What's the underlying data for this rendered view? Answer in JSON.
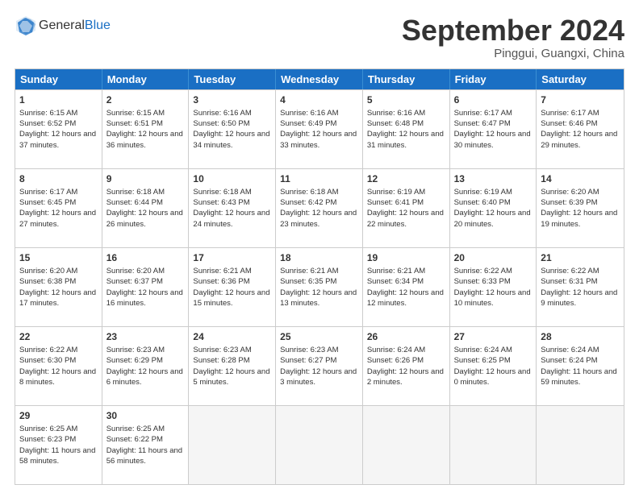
{
  "header": {
    "logo_general": "General",
    "logo_blue": "Blue",
    "month_title": "September 2024",
    "location": "Pinggui, Guangxi, China"
  },
  "weekdays": [
    "Sunday",
    "Monday",
    "Tuesday",
    "Wednesday",
    "Thursday",
    "Friday",
    "Saturday"
  ],
  "rows": [
    [
      {
        "day": "",
        "info": ""
      },
      {
        "day": "2",
        "info": "Sunrise: 6:15 AM\nSunset: 6:51 PM\nDaylight: 12 hours\nand 36 minutes."
      },
      {
        "day": "3",
        "info": "Sunrise: 6:16 AM\nSunset: 6:50 PM\nDaylight: 12 hours\nand 34 minutes."
      },
      {
        "day": "4",
        "info": "Sunrise: 6:16 AM\nSunset: 6:49 PM\nDaylight: 12 hours\nand 33 minutes."
      },
      {
        "day": "5",
        "info": "Sunrise: 6:16 AM\nSunset: 6:48 PM\nDaylight: 12 hours\nand 31 minutes."
      },
      {
        "day": "6",
        "info": "Sunrise: 6:17 AM\nSunset: 6:47 PM\nDaylight: 12 hours\nand 30 minutes."
      },
      {
        "day": "7",
        "info": "Sunrise: 6:17 AM\nSunset: 6:46 PM\nDaylight: 12 hours\nand 29 minutes."
      }
    ],
    [
      {
        "day": "8",
        "info": "Sunrise: 6:17 AM\nSunset: 6:45 PM\nDaylight: 12 hours\nand 27 minutes."
      },
      {
        "day": "9",
        "info": "Sunrise: 6:18 AM\nSunset: 6:44 PM\nDaylight: 12 hours\nand 26 minutes."
      },
      {
        "day": "10",
        "info": "Sunrise: 6:18 AM\nSunset: 6:43 PM\nDaylight: 12 hours\nand 24 minutes."
      },
      {
        "day": "11",
        "info": "Sunrise: 6:18 AM\nSunset: 6:42 PM\nDaylight: 12 hours\nand 23 minutes."
      },
      {
        "day": "12",
        "info": "Sunrise: 6:19 AM\nSunset: 6:41 PM\nDaylight: 12 hours\nand 22 minutes."
      },
      {
        "day": "13",
        "info": "Sunrise: 6:19 AM\nSunset: 6:40 PM\nDaylight: 12 hours\nand 20 minutes."
      },
      {
        "day": "14",
        "info": "Sunrise: 6:20 AM\nSunset: 6:39 PM\nDaylight: 12 hours\nand 19 minutes."
      }
    ],
    [
      {
        "day": "15",
        "info": "Sunrise: 6:20 AM\nSunset: 6:38 PM\nDaylight: 12 hours\nand 17 minutes."
      },
      {
        "day": "16",
        "info": "Sunrise: 6:20 AM\nSunset: 6:37 PM\nDaylight: 12 hours\nand 16 minutes."
      },
      {
        "day": "17",
        "info": "Sunrise: 6:21 AM\nSunset: 6:36 PM\nDaylight: 12 hours\nand 15 minutes."
      },
      {
        "day": "18",
        "info": "Sunrise: 6:21 AM\nSunset: 6:35 PM\nDaylight: 12 hours\nand 13 minutes."
      },
      {
        "day": "19",
        "info": "Sunrise: 6:21 AM\nSunset: 6:34 PM\nDaylight: 12 hours\nand 12 minutes."
      },
      {
        "day": "20",
        "info": "Sunrise: 6:22 AM\nSunset: 6:33 PM\nDaylight: 12 hours\nand 10 minutes."
      },
      {
        "day": "21",
        "info": "Sunrise: 6:22 AM\nSunset: 6:31 PM\nDaylight: 12 hours\nand 9 minutes."
      }
    ],
    [
      {
        "day": "22",
        "info": "Sunrise: 6:22 AM\nSunset: 6:30 PM\nDaylight: 12 hours\nand 8 minutes."
      },
      {
        "day": "23",
        "info": "Sunrise: 6:23 AM\nSunset: 6:29 PM\nDaylight: 12 hours\nand 6 minutes."
      },
      {
        "day": "24",
        "info": "Sunrise: 6:23 AM\nSunset: 6:28 PM\nDaylight: 12 hours\nand 5 minutes."
      },
      {
        "day": "25",
        "info": "Sunrise: 6:23 AM\nSunset: 6:27 PM\nDaylight: 12 hours\nand 3 minutes."
      },
      {
        "day": "26",
        "info": "Sunrise: 6:24 AM\nSunset: 6:26 PM\nDaylight: 12 hours\nand 2 minutes."
      },
      {
        "day": "27",
        "info": "Sunrise: 6:24 AM\nSunset: 6:25 PM\nDaylight: 12 hours\nand 0 minutes."
      },
      {
        "day": "28",
        "info": "Sunrise: 6:24 AM\nSunset: 6:24 PM\nDaylight: 11 hours\nand 59 minutes."
      }
    ],
    [
      {
        "day": "29",
        "info": "Sunrise: 6:25 AM\nSunset: 6:23 PM\nDaylight: 11 hours\nand 58 minutes."
      },
      {
        "day": "30",
        "info": "Sunrise: 6:25 AM\nSunset: 6:22 PM\nDaylight: 11 hours\nand 56 minutes."
      },
      {
        "day": "",
        "info": ""
      },
      {
        "day": "",
        "info": ""
      },
      {
        "day": "",
        "info": ""
      },
      {
        "day": "",
        "info": ""
      },
      {
        "day": "",
        "info": ""
      }
    ]
  ],
  "row0_day1": {
    "day": "1",
    "info": "Sunrise: 6:15 AM\nSunset: 6:52 PM\nDaylight: 12 hours\nand 37 minutes."
  }
}
